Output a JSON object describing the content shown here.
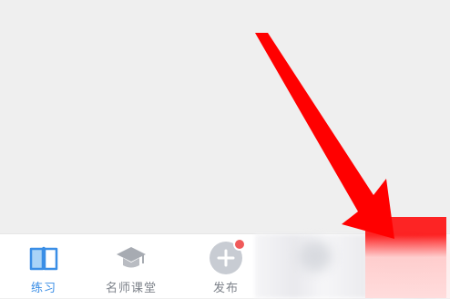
{
  "tabbar": {
    "tabs": [
      {
        "label": "练习",
        "icon": "book-icon",
        "active": true,
        "color": "#3a8ee6"
      },
      {
        "label": "名师课堂",
        "icon": "graduation-cap-icon",
        "active": false,
        "color": "#9aa0a8"
      },
      {
        "label": "发布",
        "icon": "plus-circle-icon",
        "active": false,
        "color": "#9aa0a8",
        "badge": true
      }
    ]
  },
  "colors": {
    "accent": "#3a8ee6",
    "inactive": "#9aa0a8",
    "badge": "#f05a5a",
    "annotation": "#ff0000"
  }
}
